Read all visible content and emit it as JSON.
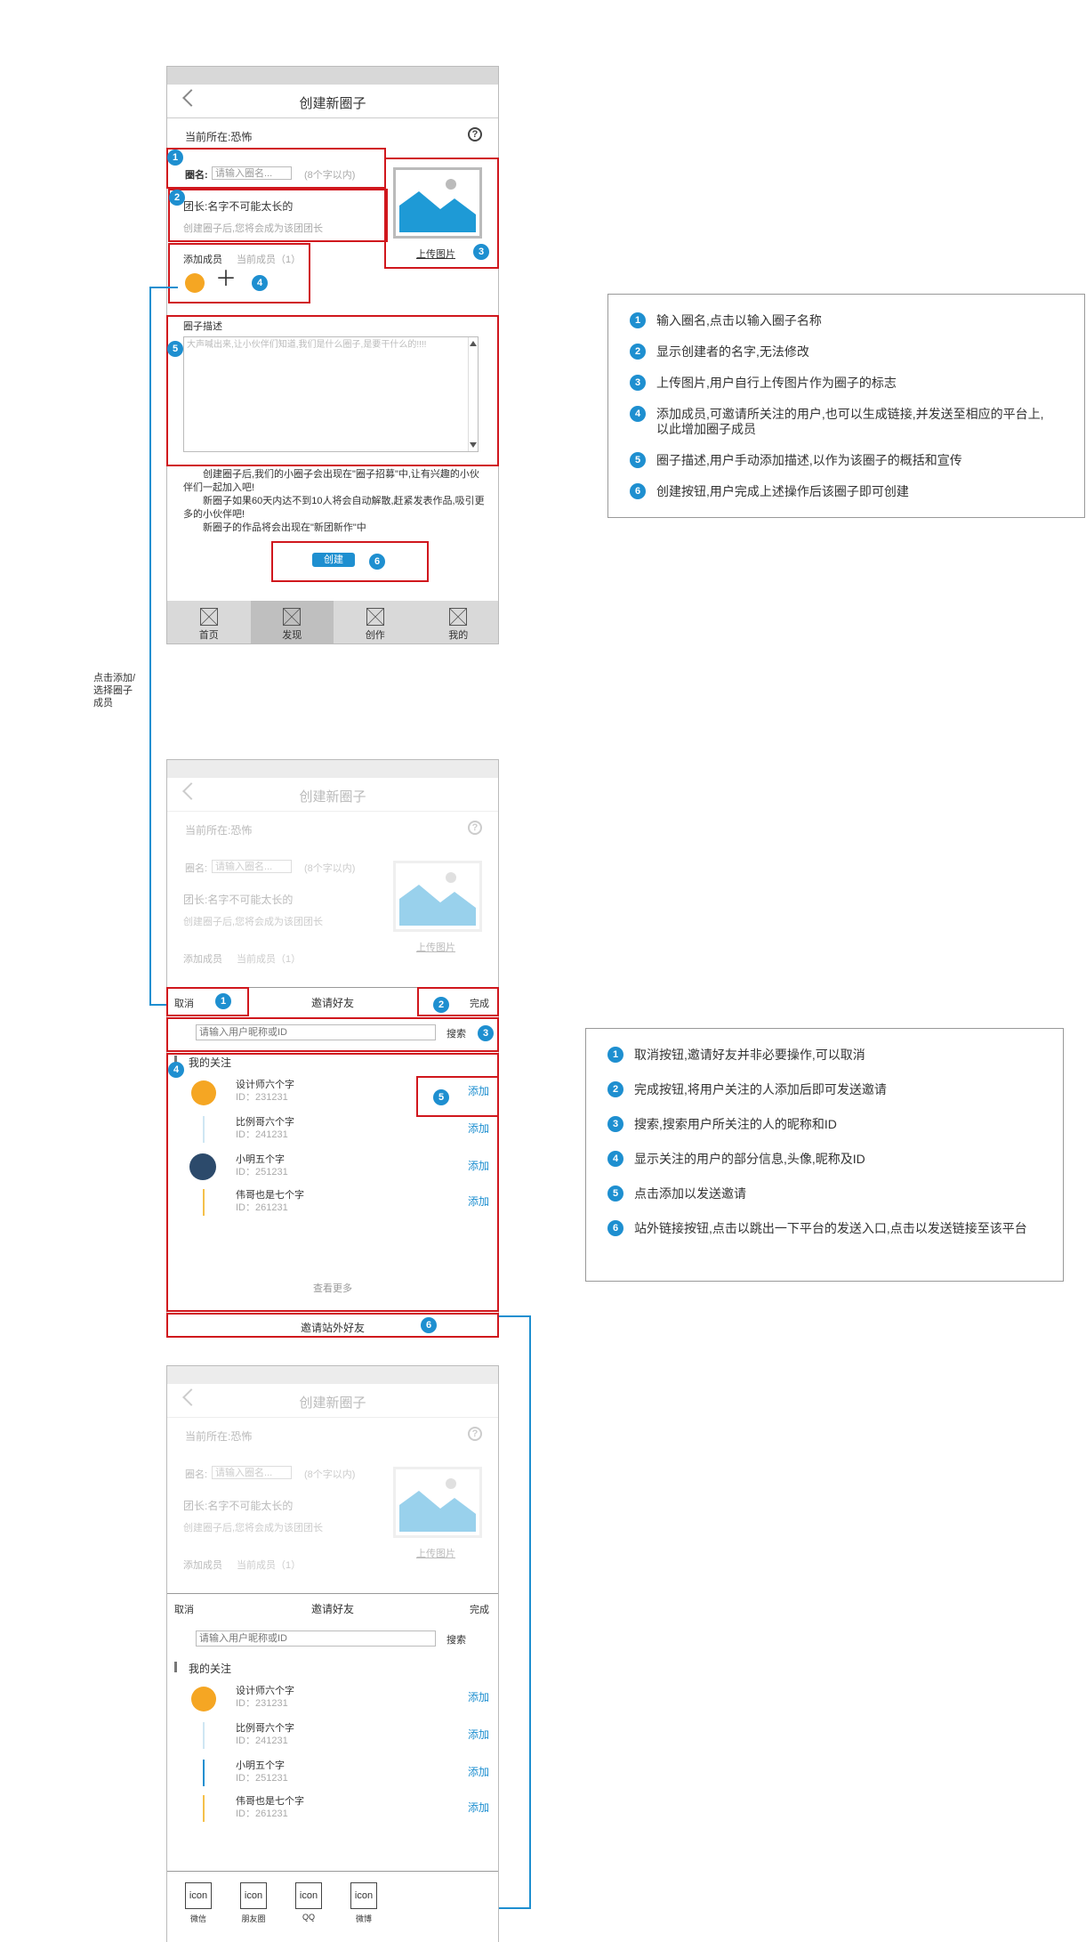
{
  "side_note": "点击添加/\n选择圈子\n成员",
  "screen1": {
    "title": "创建新圈子",
    "location": "当前所在:恐怖",
    "help_icon": "question-icon",
    "circle_name_label": "圈名:",
    "circle_name_placeholder": "请输入圈名...",
    "circle_name_hint": "(8个字以内)",
    "leader": "团长:名字不可能太长的",
    "leader_hint": "创建圈子后,您将会成为该团团长",
    "upload_label": "上传图片",
    "add_members_label": "添加成员",
    "members_count": "当前成员（1）",
    "plus": "＋",
    "desc_label": "圈子描述",
    "desc_placeholder": "大声喊出来,让小伙伴们知道,我们是什么圈子,是要干什么的!!!!",
    "info_text": "　　创建圈子后,我们的小圈子会出现在\"圈子招募\"中,让有兴趣的小伙伴们一起加入吧!\n　　新圈子如果60天内达不到10人将会自动解散,赶紧发表作品,吸引更多的小伙伴吧!\n　　新圈子的作品将会出现在\"新团新作\"中",
    "create_button": "创建",
    "tabs": [
      "首页",
      "发现",
      "创作",
      "我的"
    ],
    "badges": [
      "1",
      "2",
      "3",
      "4",
      "5",
      "6"
    ]
  },
  "notes1": [
    {
      "num": "1",
      "text": "输入圈名,点击以输入圈子名称"
    },
    {
      "num": "2",
      "text": "显示创建者的名字,无法修改"
    },
    {
      "num": "3",
      "text": "上传图片,用户自行上传图片作为圈子的标志"
    },
    {
      "num": "4",
      "text": "添加成员,可邀请所关注的用户,也可以生成链接,并发送至相应的平台上,以此增加圈子成员"
    },
    {
      "num": "5",
      "text": "圈子描述,用户手动添加描述,以作为该圈子的概括和宣传"
    },
    {
      "num": "6",
      "text": "创建按钮,用户完成上述操作后该圈子即可创建"
    }
  ],
  "invite": {
    "cancel": "取消",
    "title": "邀请好友",
    "done": "完成",
    "search_placeholder": "请输入用户昵称或ID",
    "search_button": "搜索",
    "following_label": "我的关注",
    "users": [
      {
        "name": "设计师六个字",
        "id": "ID：231231",
        "add": "添加"
      },
      {
        "name": "比例哥六个字",
        "id": "ID：241231",
        "add": "添加"
      },
      {
        "name": "小明五个字",
        "id": "ID：251231",
        "add": "添加"
      },
      {
        "name": "伟哥也是七个字",
        "id": "ID：261231",
        "add": "添加"
      }
    ],
    "more": "查看更多",
    "external": "邀请站外好友"
  },
  "notes2": [
    {
      "num": "1",
      "text": "取消按钮,邀请好友并非必要操作,可以取消"
    },
    {
      "num": "2",
      "text": "完成按钮,将用户关注的人添加后即可发送邀请"
    },
    {
      "num": "3",
      "text": "搜索,搜索用户所关注的人的昵称和ID"
    },
    {
      "num": "4",
      "text": "显示关注的用户的部分信息,头像,昵称及ID"
    },
    {
      "num": "5",
      "text": "点击添加以发送邀请"
    },
    {
      "num": "6",
      "text": "站外链接按钮,点击以跳出一下平台的发送入口,点击以发送链接至该平台"
    }
  ],
  "share": [
    {
      "icon": "icon",
      "label": "微信"
    },
    {
      "icon": "icon",
      "label": "朋友圈"
    },
    {
      "icon": "icon",
      "label": "QQ"
    },
    {
      "icon": "icon",
      "label": "微博"
    }
  ],
  "colors": {
    "accent": "#1e8fd0",
    "highlight": "#d0171d",
    "bar": "#d9d9d9"
  }
}
